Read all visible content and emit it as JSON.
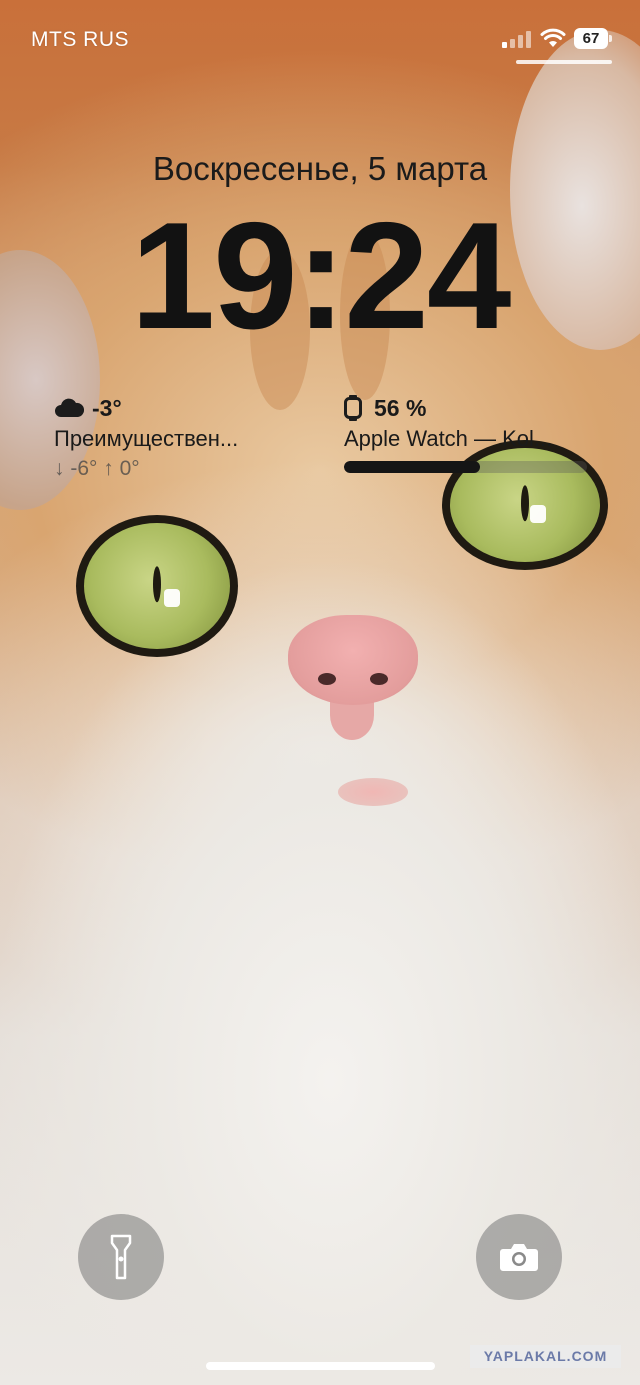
{
  "status_bar": {
    "carrier": "MTS RUS",
    "battery_level": "67",
    "signal_bars_active": 1,
    "signal_bars_total": 4,
    "icons": [
      "signal-icon",
      "wifi-icon",
      "battery-icon"
    ]
  },
  "lock_screen": {
    "date": "Воскресенье, 5 марта",
    "time": "19:24"
  },
  "widgets": {
    "weather": {
      "icon": "cloud-icon",
      "temperature": "-3°",
      "condition": "Преимуществен...",
      "range": "↓ -6° ↑ 0°"
    },
    "battery": {
      "icon": "apple-watch-icon",
      "percent": "56 %",
      "percent_value": 0.56,
      "device": "Apple Watch — Kol..."
    }
  },
  "controls": {
    "flashlight_icon": "flashlight-icon",
    "camera_icon": "camera-icon"
  },
  "watermark": "YAPLAKAL.COM",
  "colors": {
    "clock_text": "#121212",
    "button_bg": "#787878",
    "battery_fill": "#151515"
  }
}
